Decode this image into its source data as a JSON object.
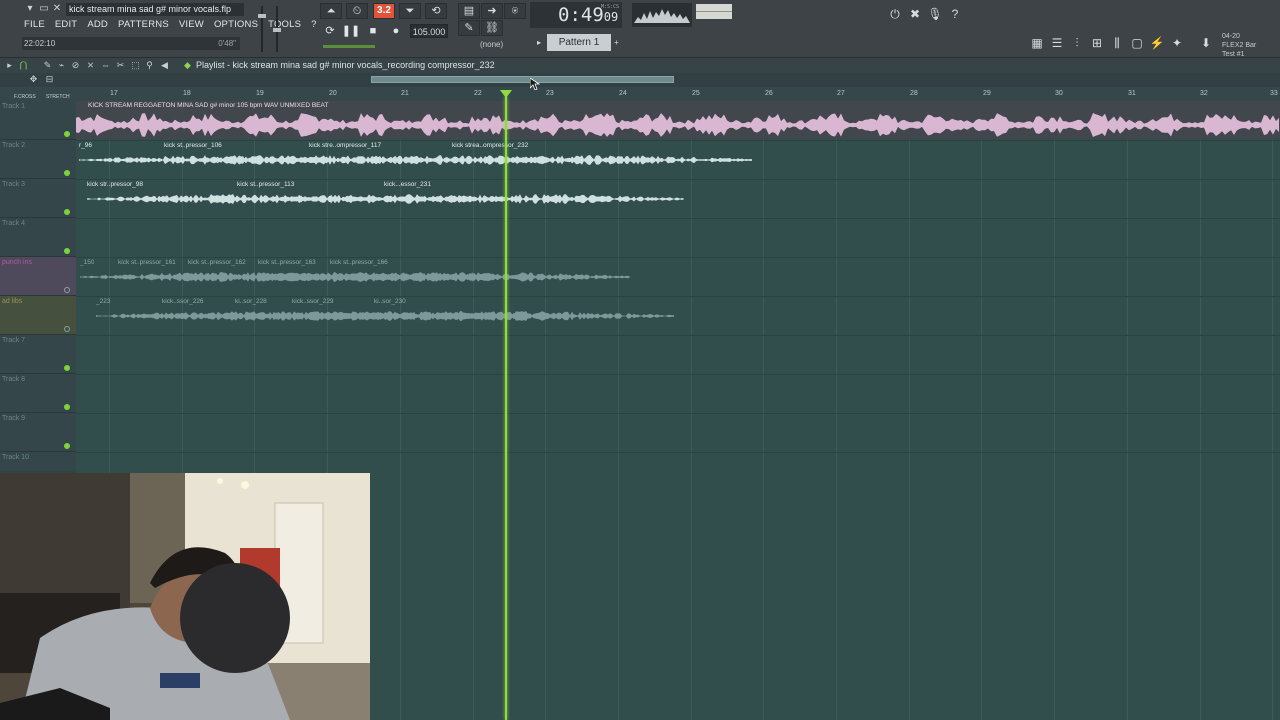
{
  "app": {
    "project_title": "kick stream mina sad g# minor vocals.flp",
    "menu": [
      "FILE",
      "EDIT",
      "ADD",
      "PATTERNS",
      "VIEW",
      "OPTIONS",
      "TOOLS",
      "?"
    ],
    "hint_left": "22:02:10",
    "hint_right": "0'48\""
  },
  "transport": {
    "time": "0:49",
    "time_frac": "09",
    "time_unit": "M:S:CS",
    "tempo": "105.000",
    "snap": "(none)",
    "pattern": "Pattern 1",
    "record_counter": "3.2"
  },
  "right_panel": {
    "flex_line1": "04-20",
    "flex_line2": "FLEX2 Bar",
    "flex_line3": "Test #1"
  },
  "playlist": {
    "title": "Playlist - kick stream mina sad g# minor vocals_recording compressor_232",
    "ruler_labels": [
      "F.CROSS",
      "STRETCH"
    ],
    "ruler": [
      "17",
      "18",
      "19",
      "20",
      "21",
      "22",
      "23",
      "24",
      "25",
      "26",
      "27",
      "28",
      "29",
      "30",
      "31",
      "32",
      "33"
    ],
    "tracks": [
      "Track 1",
      "Track 2",
      "Track 3",
      "Track 4",
      "punch ins",
      "ad libs",
      "Track 7",
      "Track 8",
      "Track 9",
      "Track 10"
    ],
    "beat_clip": "KICK STREAM REGGAETON MINA SAD g# minor 105 bpm WAV UNMIXED BEAT",
    "clips_track2": [
      "r_96",
      "kick st..pressor_106",
      "kick stre..ompressor_117",
      "kick strea..ompressor_232"
    ],
    "clips_track3": [
      "kick str..pressor_98",
      "kick st..pressor_113",
      "kick...essor_231"
    ],
    "clips_track5": [
      "_150",
      "kick st..pressor_161",
      "kick st..pressor_162",
      "kick st..pressor_163",
      "kick st..pressor_166"
    ],
    "clips_track6": [
      "_223",
      "kick..ssor_226",
      "ki..sor_228",
      "kick..ssor_229",
      "ki..sor_230"
    ]
  },
  "colors": {
    "grid": "#314d4c",
    "playhead": "#8fdc3e",
    "beat_wave": "#d9b7d3",
    "clip_wave": "#cfe0e1",
    "record": "#e2543a"
  },
  "icons": [
    "pin-icon",
    "minimize-icon",
    "maximize-icon",
    "close-icon",
    "play-icon",
    "stop-icon",
    "record-icon",
    "loop-icon",
    "metronome-icon",
    "pencil-icon",
    "brush-icon",
    "delete-icon",
    "mute-icon",
    "slice-icon",
    "select-icon",
    "zoom-icon",
    "playback-icon",
    "cursor-icon"
  ]
}
